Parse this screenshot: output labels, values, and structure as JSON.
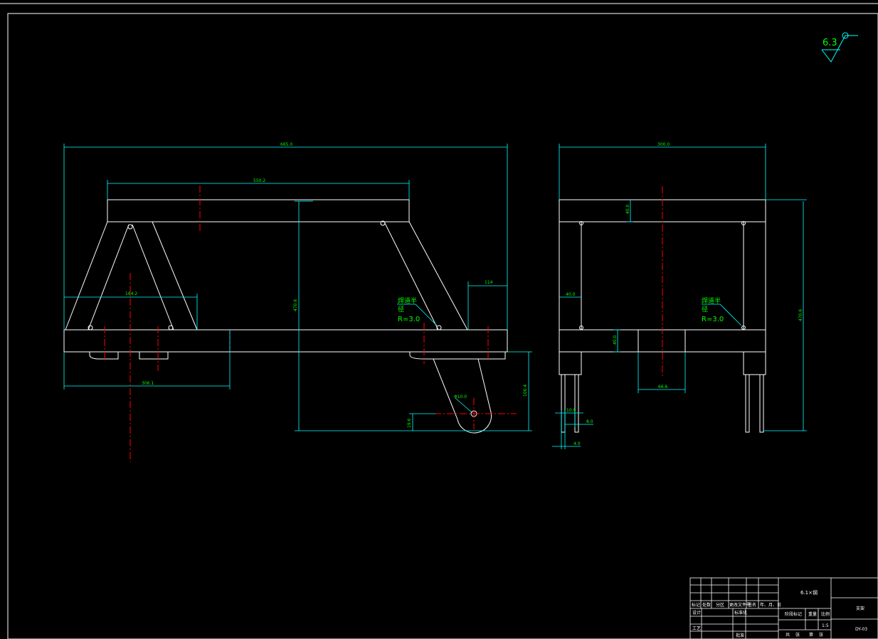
{
  "drawing": {
    "surface_finish": "6.3",
    "colors": {
      "background": "#000000",
      "outline": "#ffffff",
      "dimension": "#00ffff",
      "dim_text": "#00ff00",
      "centerline": "#ff0000",
      "hidden": "#ff00ff",
      "title_block": "#ffffff"
    },
    "front_view": {
      "dims": {
        "overall_length": "665.0",
        "top_length": "550.2",
        "height": "470.6",
        "right_offset": "114",
        "a_frame_width": "164.2",
        "lower_length": "306.1",
        "drop_height": "100.4",
        "pin_hole": "Φ10.0",
        "pin_offset": "19.6"
      },
      "weld_note_1": "焊道半",
      "weld_note_2": "径",
      "weld_radius": "R=3.0"
    },
    "side_view": {
      "dims": {
        "overall_width": "300.0",
        "height": "470.6",
        "top_thickness": "40.0",
        "post_width": "40.0",
        "lower_height": "40.0",
        "mid_width": "66.6",
        "leg_gap": "10.0",
        "leg_dim_right": "8.0",
        "leg_dim_bottom": "4.0"
      },
      "weld_note_1": "焊道半",
      "weld_note_2": "径",
      "weld_radius": "R=3.0"
    },
    "title_block": {
      "title": "6.1×钢",
      "row_labels": [
        "标记",
        "处数",
        "分区",
        "更改文件号",
        "签名",
        "年、月、日"
      ],
      "designer": "设计",
      "standard": "标准化",
      "stage_labels": [
        "阶段标记",
        "重量",
        "比例"
      ],
      "scale": "1:5",
      "process": "工艺",
      "approve": "批准",
      "sheet_labels": [
        "共",
        "张",
        "第",
        "张"
      ],
      "material": "支架",
      "code": "DY-03"
    }
  }
}
